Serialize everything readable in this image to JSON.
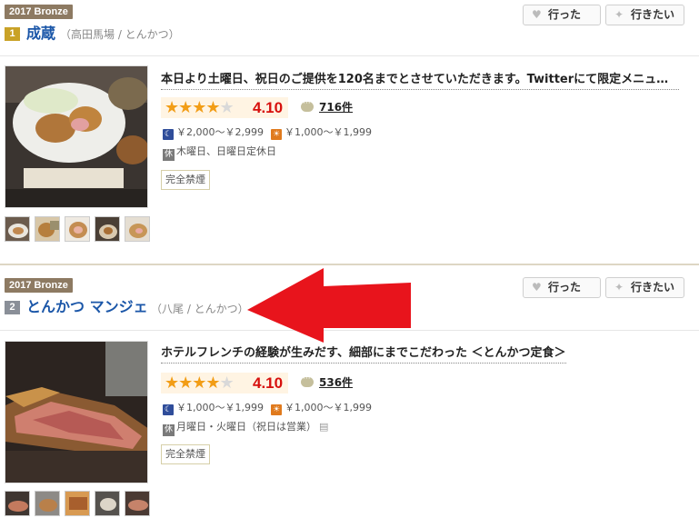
{
  "restaurants": [
    {
      "award": "2017 Bronze",
      "rank": "1",
      "name": "成蔵",
      "meta": "（高田馬場 / とんかつ）",
      "headline": "本日より土曜日、祝日のご提供を120名までとさせていただきます。Twitterにて限定メニュー…",
      "rating": "4.10",
      "stars": 4,
      "reviews": "716件",
      "dinner_price": "￥2,000～￥2,999",
      "lunch_price": "￥1,000～￥1,999",
      "holiday": "木曜日、日曜日定休日",
      "smoking": "完全禁煙",
      "buttons": {
        "went": "行った",
        "want": "行きたい"
      }
    },
    {
      "award": "2017 Bronze",
      "rank": "2",
      "name": "とんかつ マンジェ",
      "meta": "（八尾 / とんかつ）",
      "headline": "ホテルフレンチの経験が生みだす、細部にまでこだわった ＜とんかつ定食＞",
      "rating": "4.10",
      "stars": 4,
      "reviews": "536件",
      "dinner_price": "￥1,000～￥1,999",
      "lunch_price": "￥1,000～￥1,999",
      "holiday": "月曜日・火曜日（祝日は営業）",
      "smoking": "完全禁煙",
      "buttons": {
        "went": "行った",
        "want": "行きたい"
      }
    }
  ],
  "colors": {
    "award_badge": "#8d7a62",
    "shop_link": "#1a56a8",
    "score": "#d7100d",
    "star": "#f29d16",
    "annotation_arrow": "#e8141c"
  },
  "icons": {
    "went_button": "heart-icon",
    "want_button": "pin-icon",
    "dinner": "moon-icon",
    "lunch": "sun-icon",
    "holiday": "closed-day-icon",
    "reviews": "speech-bubble-icon"
  }
}
